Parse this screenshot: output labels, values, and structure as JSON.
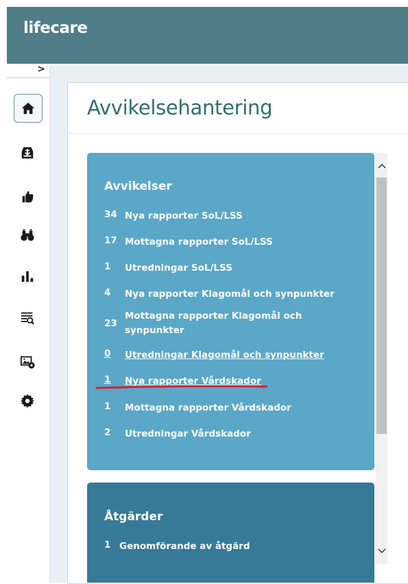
{
  "header": {
    "brand": "lifecare"
  },
  "sidebar": {
    "expand_glyph": ">",
    "items": [
      {
        "icon": "home-icon"
      },
      {
        "icon": "inbox-download-icon"
      },
      {
        "icon": "thumbs-up-icon"
      },
      {
        "icon": "binoculars-icon"
      },
      {
        "icon": "bar-chart-icon"
      },
      {
        "icon": "list-search-icon"
      },
      {
        "icon": "image-settings-icon"
      },
      {
        "icon": "gear-icon"
      }
    ]
  },
  "main": {
    "page_title": "Avvikelsehantering",
    "cards": [
      {
        "title": "Avvikelser",
        "rows": [
          {
            "count": "34",
            "label": "Nya rapporter SoL/LSS"
          },
          {
            "count": "17",
            "label": "Mottagna rapporter SoL/LSS"
          },
          {
            "count": "1",
            "label": "Utredningar SoL/LSS"
          },
          {
            "count": "4",
            "label": "Nya rapporter Klagomål och synpunkter"
          },
          {
            "count": "23",
            "label": "Mottagna rapporter Klagomål och synpunkter"
          },
          {
            "count": "0",
            "label": "Utredningar Klagomål och synpunkter"
          },
          {
            "count": "1",
            "label": "Nya rapporter Vårdskador"
          },
          {
            "count": "1",
            "label": "Mottagna rapporter Vårdskador"
          },
          {
            "count": "2",
            "label": "Utredningar Vårdskador"
          }
        ]
      },
      {
        "title": "Åtgärder",
        "rows": [
          {
            "count": "1",
            "label": "Genomförande av åtgärd"
          }
        ]
      }
    ]
  },
  "colors": {
    "header_bg": "#4f7e88",
    "card_blue": "#5aa7c8",
    "card_dark": "#367a97",
    "title_color": "#2f6f73",
    "annotation_red": "#d9232a"
  }
}
